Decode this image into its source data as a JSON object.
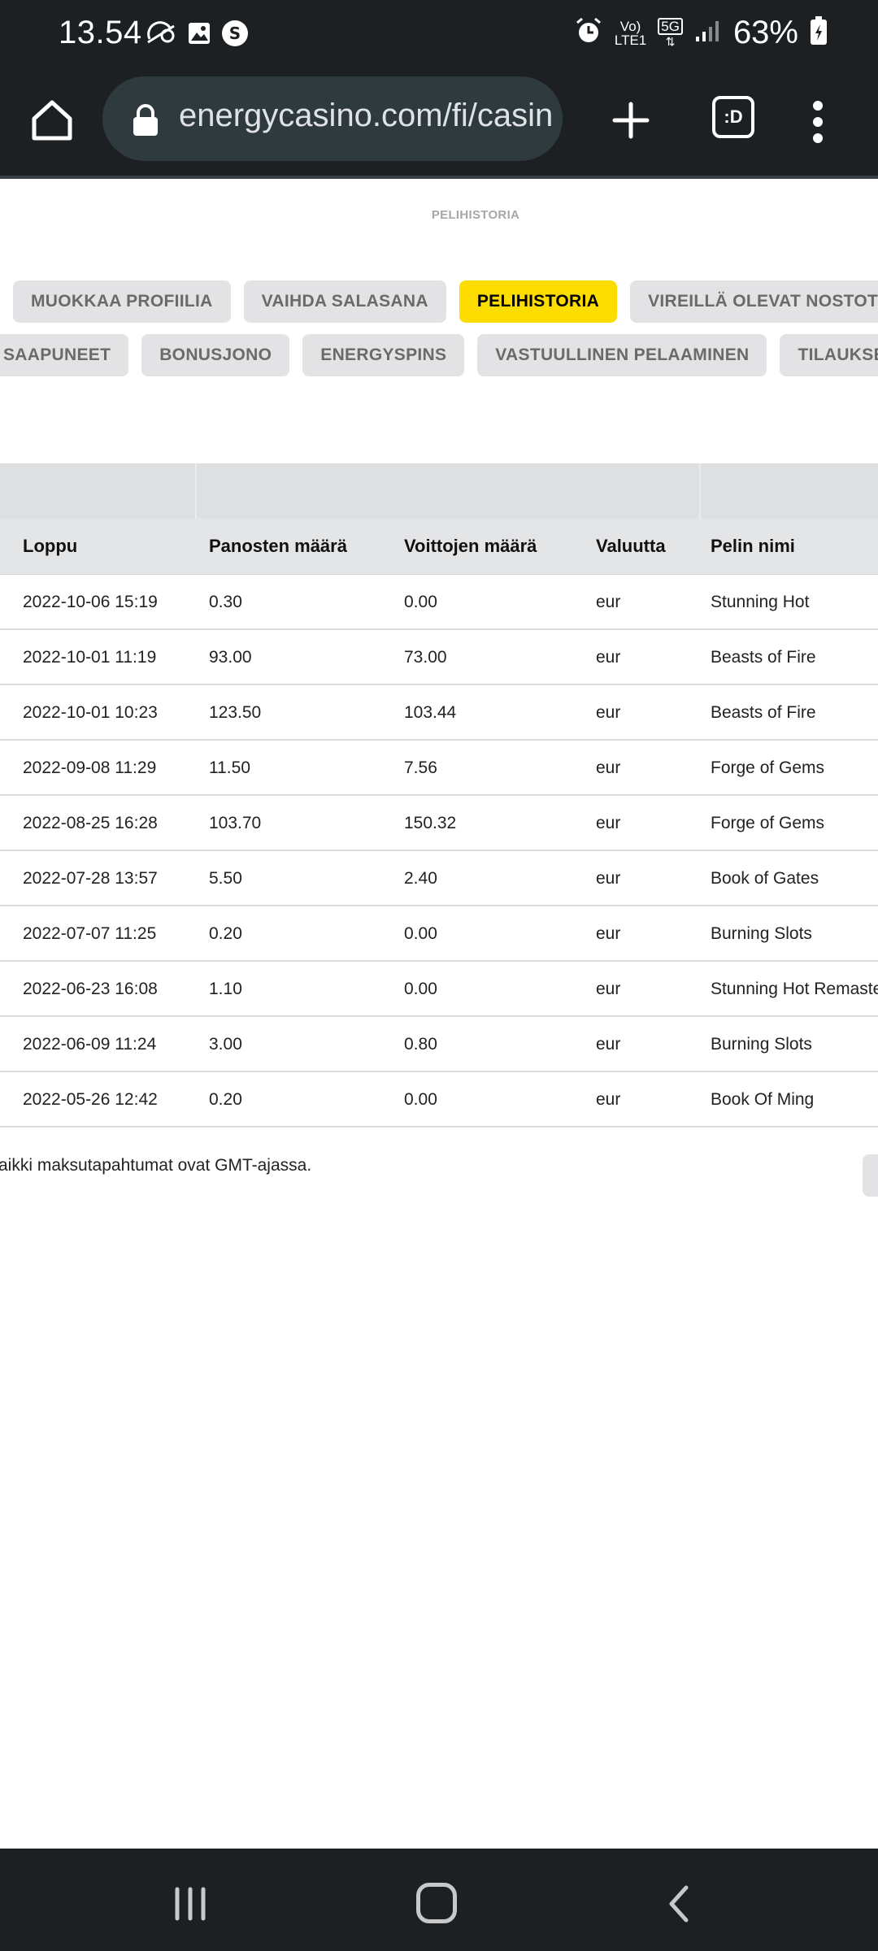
{
  "status_bar": {
    "time": "13.54",
    "network_top": "Vo)",
    "network_bottom": "LTE1",
    "network_type": "5G",
    "battery": "63%",
    "icons": [
      "data-saver-icon",
      "gallery-icon",
      "s-app-icon",
      "alarm-icon",
      "signal-icon",
      "battery-icon"
    ]
  },
  "browser": {
    "url": "energycasino.com/fi/casino",
    "tabs_label": ":D",
    "icons": [
      "home-icon",
      "lock-icon",
      "plus-icon",
      "tabs-icon",
      "menu-dots-icon"
    ]
  },
  "page": {
    "title": "PELIHISTORIA",
    "tabs_row1": [
      "MUOKKAA PROFIILIA",
      "VAIHDA SALASANA",
      "PELIHISTORIA",
      "VIREILLÄ OLEVAT NOSTOT"
    ],
    "tabs_row2": [
      "SAAPUNEET",
      "BONUSJONO",
      "ENERGYSPINS",
      "VASTUULLINEN PELAAMINEN",
      "TILAUKSET"
    ],
    "active_tab": "PELIHISTORIA"
  },
  "table": {
    "headers": [
      "Loppu",
      "Panosten määrä",
      "Voittojen määrä",
      "Valuutta",
      "Pelin nimi"
    ],
    "rows": [
      [
        "2022-10-06 15:19",
        "0.30",
        "0.00",
        "eur",
        "Stunning Hot"
      ],
      [
        "2022-10-01 11:19",
        "93.00",
        "73.00",
        "eur",
        "Beasts of Fire"
      ],
      [
        "2022-10-01 10:23",
        "123.50",
        "103.44",
        "eur",
        "Beasts of Fire"
      ],
      [
        "2022-09-08 11:29",
        "11.50",
        "7.56",
        "eur",
        "Forge of Gems"
      ],
      [
        "2022-08-25 16:28",
        "103.70",
        "150.32",
        "eur",
        "Forge of Gems"
      ],
      [
        "2022-07-28 13:57",
        "5.50",
        "2.40",
        "eur",
        "Book of Gates"
      ],
      [
        "2022-07-07 11:25",
        "0.20",
        "0.00",
        "eur",
        "Burning Slots"
      ],
      [
        "2022-06-23 16:08",
        "1.10",
        "0.00",
        "eur",
        "Stunning Hot Remastered"
      ],
      [
        "2022-06-09 11:24",
        "3.00",
        "0.80",
        "eur",
        "Burning Slots"
      ],
      [
        "2022-05-26 12:42",
        "0.20",
        "0.00",
        "eur",
        "Book Of Ming"
      ]
    ]
  },
  "footnote": "Kaikki maksutapahtumat ovat GMT-ajassa.",
  "colors": {
    "system_bar": "#1c2023",
    "active_tab": "#fddc00",
    "tab_bg": "#e3e3e5",
    "header_bg": "#e4e5e7"
  },
  "navbar": {
    "icons": [
      "recent-apps-icon",
      "home-nav-icon",
      "back-icon"
    ]
  }
}
